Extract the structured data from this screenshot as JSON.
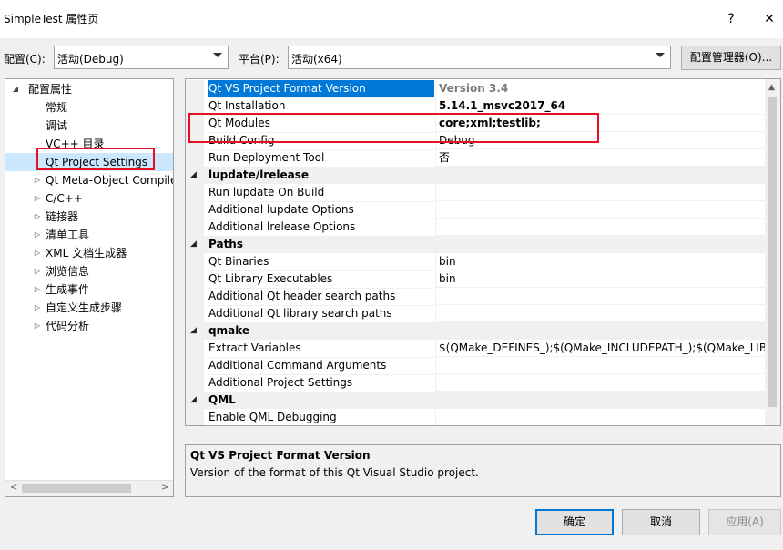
{
  "window": {
    "title": "SimpleTest 属性页",
    "help_glyph": "?",
    "close_glyph": "✕"
  },
  "config_bar": {
    "config_label": "配置(C):",
    "config_value": "活动(Debug)",
    "platform_label": "平台(P):",
    "platform_value": "活动(x64)",
    "manager_button": "配置管理器(O)..."
  },
  "tree": {
    "items": [
      {
        "label": "配置属性",
        "expander": "◢",
        "level": 0
      },
      {
        "label": "常规",
        "expander": "",
        "level": 1
      },
      {
        "label": "调试",
        "expander": "",
        "level": 1
      },
      {
        "label": "VC++ 目录",
        "expander": "",
        "level": 1
      },
      {
        "label": "Qt Project Settings",
        "expander": "",
        "level": 1,
        "selected": true
      },
      {
        "label": "Qt Meta-Object Compiler",
        "expander": "▷",
        "level": 1
      },
      {
        "label": "C/C++",
        "expander": "▷",
        "level": 1
      },
      {
        "label": "链接器",
        "expander": "▷",
        "level": 1
      },
      {
        "label": "清单工具",
        "expander": "▷",
        "level": 1
      },
      {
        "label": "XML 文档生成器",
        "expander": "▷",
        "level": 1
      },
      {
        "label": "浏览信息",
        "expander": "▷",
        "level": 1
      },
      {
        "label": "生成事件",
        "expander": "▷",
        "level": 1
      },
      {
        "label": "自定义生成步骤",
        "expander": "▷",
        "level": 1
      },
      {
        "label": "代码分析",
        "expander": "▷",
        "level": 1
      }
    ],
    "scroll_left": "<",
    "scroll_right": ">"
  },
  "grid": {
    "rows": [
      {
        "type": "prop",
        "name": "Qt VS Project Format Version",
        "value": "Version 3.4",
        "selected": true,
        "bold": true
      },
      {
        "type": "prop",
        "name": "Qt Installation",
        "value": "5.14.1_msvc2017_64",
        "bold": true
      },
      {
        "type": "prop",
        "name": "Qt Modules",
        "value": "core;xml;testlib;",
        "bold": true
      },
      {
        "type": "prop",
        "name": "Build Config",
        "value": "Debug"
      },
      {
        "type": "prop",
        "name": "Run Deployment Tool",
        "value": "否"
      },
      {
        "type": "cat",
        "name": "lupdate/lrelease",
        "expander": "◢"
      },
      {
        "type": "prop",
        "name": "Run lupdate On Build",
        "value": ""
      },
      {
        "type": "prop",
        "name": "Additional lupdate Options",
        "value": ""
      },
      {
        "type": "prop",
        "name": "Additional lrelease Options",
        "value": ""
      },
      {
        "type": "cat",
        "name": "Paths",
        "expander": "◢"
      },
      {
        "type": "prop",
        "name": "Qt Binaries",
        "value": "bin"
      },
      {
        "type": "prop",
        "name": "Qt Library Executables",
        "value": "bin"
      },
      {
        "type": "prop",
        "name": "Additional Qt header search paths",
        "value": ""
      },
      {
        "type": "prop",
        "name": "Additional Qt library search paths",
        "value": ""
      },
      {
        "type": "cat",
        "name": "qmake",
        "expander": "◢"
      },
      {
        "type": "prop",
        "name": "Extract Variables",
        "value": "$(QMake_DEFINES_);$(QMake_INCLUDEPATH_);$(QMake_LIBS_)"
      },
      {
        "type": "prop",
        "name": "Additional Command Arguments",
        "value": ""
      },
      {
        "type": "prop",
        "name": "Additional Project Settings",
        "value": ""
      },
      {
        "type": "cat",
        "name": "QML",
        "expander": "◢"
      },
      {
        "type": "prop",
        "name": "Enable QML Debugging",
        "value": ""
      }
    ],
    "scroll_up": "▲"
  },
  "description": {
    "title": "Qt VS Project Format Version",
    "text": "Version of the format of this Qt Visual Studio project."
  },
  "buttons": {
    "ok": "确定",
    "cancel": "取消",
    "apply": "应用(A)"
  },
  "colors": {
    "selection": "#0078d7",
    "highlight_box": "#e81123",
    "tree_selection": "#cce8ff"
  }
}
